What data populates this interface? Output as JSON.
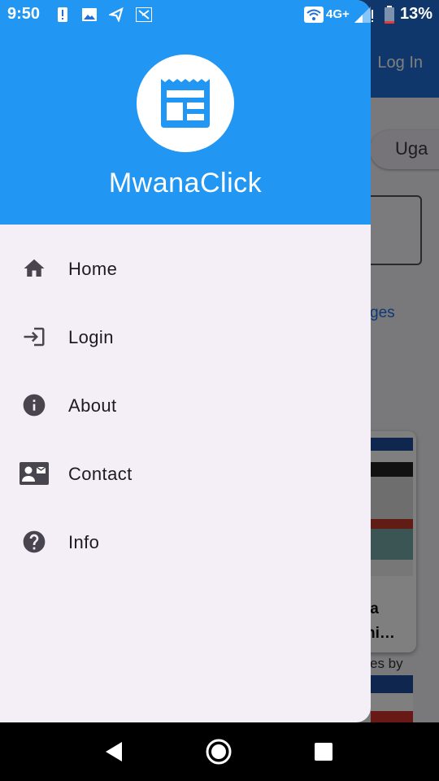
{
  "status_bar": {
    "time": "9:50",
    "network": "4G+",
    "battery": "13%",
    "icons": [
      "alert-icon",
      "image-icon",
      "send-icon",
      "translate-icon",
      "wifi-icon",
      "signal-icon",
      "battery-icon"
    ]
  },
  "background_app": {
    "login_label": "Log In",
    "chip_label": "Uga",
    "link_label": "ges",
    "card_title_line1": "ia",
    "card_title_line2": "hi…",
    "caption": "es by"
  },
  "drawer": {
    "app_name": "MwanaClick",
    "logo_icon": "newspaper-icon",
    "items": [
      {
        "label": "Home",
        "icon": "home-icon"
      },
      {
        "label": "Login",
        "icon": "login-icon"
      },
      {
        "label": "About",
        "icon": "info-circle-icon"
      },
      {
        "label": "Contact",
        "icon": "contact-card-icon"
      },
      {
        "label": "Info",
        "icon": "help-icon"
      }
    ]
  },
  "navigation_bar": {
    "buttons": [
      "back-icon",
      "home-circle-icon",
      "recents-icon"
    ]
  },
  "colors": {
    "drawer_header": "#2196f3",
    "drawer_body": "#f4eff7",
    "icon": "#49454f",
    "text": "#1d1b20"
  }
}
